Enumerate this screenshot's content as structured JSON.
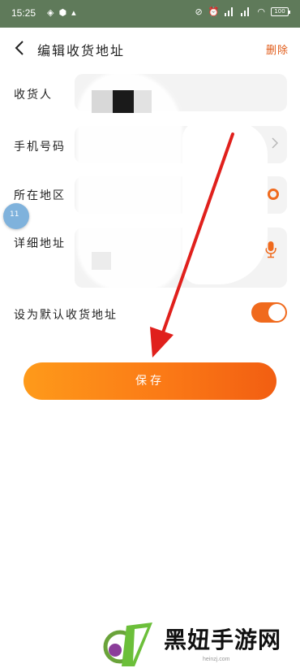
{
  "status_bar": {
    "time": "15:25",
    "battery": "100"
  },
  "header": {
    "title": "编辑收货地址",
    "delete_label": "删除"
  },
  "form": {
    "recipient_label": "收货人",
    "phone_label": "手机号码",
    "region_label": "所在地区",
    "address_label": "详细地址",
    "default_label": "设为默认收货地址",
    "default_enabled": true
  },
  "save_label": "保存",
  "floating_badge": "11",
  "watermark": {
    "brand": "黑妞手游网",
    "url": "heinzj.com"
  },
  "colors": {
    "accent": "#f06a1d",
    "arrow": "#e0201c"
  }
}
